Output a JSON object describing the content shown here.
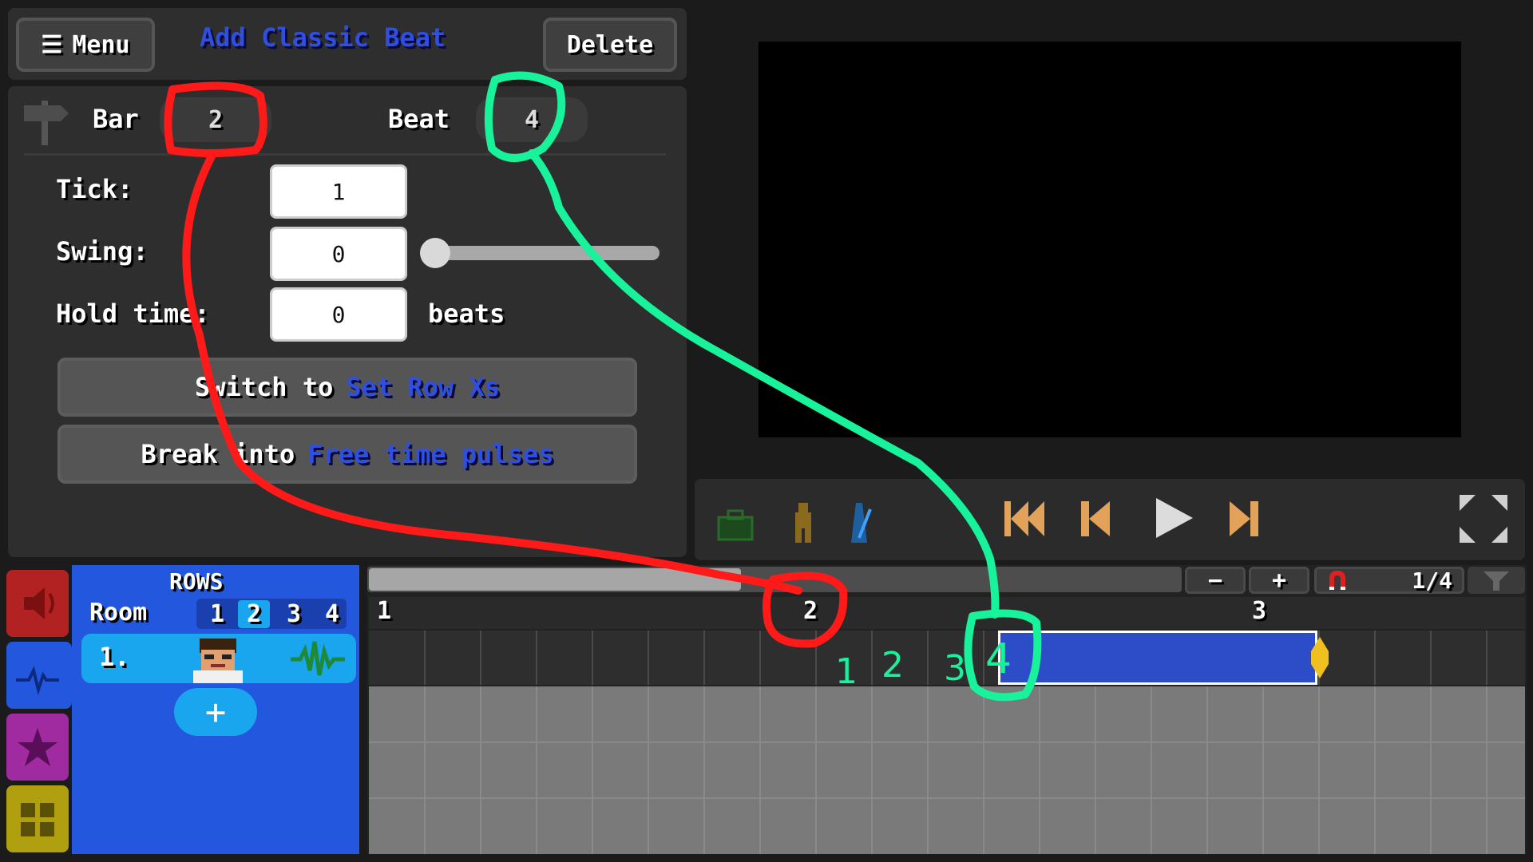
{
  "toolbar": {
    "menu_label": "Menu",
    "title_prefix": "Add",
    "title_event": "Classic Beat",
    "delete_label": "Delete"
  },
  "inspector": {
    "bar_label": "Bar",
    "bar_value": "2",
    "beat_label": "Beat",
    "beat_value": "4",
    "tick_label": "Tick:",
    "tick_value": "1",
    "swing_label": "Swing:",
    "swing_value": "0",
    "swing_slider_fraction": 0,
    "hold_label": "Hold time:",
    "hold_value": "0",
    "hold_unit": "beats",
    "switch_prefix": "Switch to",
    "switch_target": "Set Row Xs",
    "break_prefix": "Break into",
    "break_target": "Free time pulses"
  },
  "rows_panel": {
    "header": "ROWS",
    "room_label": "Room",
    "rooms": [
      "1",
      "2",
      "3",
      "4"
    ],
    "selected_room": "2",
    "row_number": "1.",
    "add_label": "+"
  },
  "timeline": {
    "zoom_out": "−",
    "zoom_in": "+",
    "snap_value": "1/4",
    "bar_markers": [
      "1",
      "2",
      "3"
    ]
  },
  "annotations": {
    "beat_numbers": [
      "1",
      "2",
      "3",
      "4"
    ]
  },
  "colors": {
    "accent_blue": "#2f4fe0",
    "row_panel": "#2358de",
    "row_item": "#1aa6ee",
    "annotation_red": "#ff1a1a",
    "annotation_green": "#18f29a",
    "transport_orange": "#e2a259"
  }
}
